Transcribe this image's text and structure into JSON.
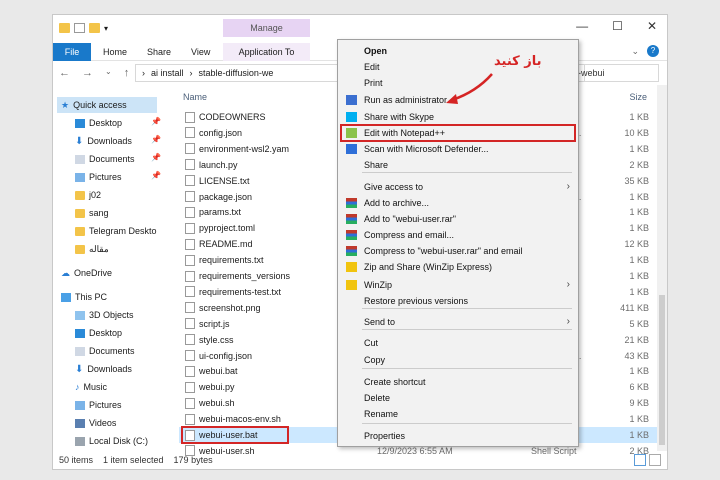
{
  "window": {
    "manage_label": "Manage",
    "tabs": [
      "File",
      "Home",
      "Share",
      "View",
      "Application To"
    ],
    "controls": [
      "—",
      "☐",
      "✕"
    ]
  },
  "address": {
    "parts": [
      "ai install",
      "stable-diffusion-we"
    ],
    "search_tail": "-webui"
  },
  "nav": {
    "quick_access": "Quick access",
    "items": [
      "Desktop",
      "Downloads",
      "Documents",
      "Pictures",
      "j02",
      "sang",
      "Telegram Deskto",
      "مقاله",
      "OneDrive",
      "This PC",
      "3D Objects",
      "Desktop",
      "Documents",
      "Downloads",
      "Music",
      "Pictures",
      "Videos",
      "Local Disk (C:)"
    ]
  },
  "columns": {
    "name": "Name",
    "size": "Size"
  },
  "files": [
    {
      "name": "CODEOWNERS",
      "type": "",
      "size": "1 KB"
    },
    {
      "name": "config.json",
      "type": "urce Effect...",
      "size": "10 KB"
    },
    {
      "name": "environment-wsl2.yam",
      "type": "",
      "size": "1 KB"
    },
    {
      "name": "launch.py",
      "type": "",
      "size": "2 KB"
    },
    {
      "name": "LICENSE.txt",
      "type": "ment",
      "size": "35 KB"
    },
    {
      "name": "package.json",
      "type": "urce Effect...",
      "size": "1 KB"
    },
    {
      "name": "params.txt",
      "type": "ment",
      "size": "1 KB"
    },
    {
      "name": "pyproject.toml",
      "type": "",
      "size": "1 KB"
    },
    {
      "name": "README.md",
      "type": "",
      "size": "12 KB"
    },
    {
      "name": "requirements.txt",
      "type": "ment",
      "size": "1 KB"
    },
    {
      "name": "requirements_versions",
      "type": "ment",
      "size": "1 KB"
    },
    {
      "name": "requirements-test.txt",
      "type": "ment",
      "size": "1 KB"
    },
    {
      "name": "screenshot.png",
      "type": "",
      "size": "411 KB"
    },
    {
      "name": "script.js",
      "type": "File",
      "size": "5 KB"
    },
    {
      "name": "style.css",
      "type": "Style S...",
      "size": "21 KB"
    },
    {
      "name": "ui-config.json",
      "type": "urce Effect...",
      "size": "43 KB"
    },
    {
      "name": "webui.bat",
      "type": "atch File",
      "size": "1 KB"
    },
    {
      "name": "webui.py",
      "type": "",
      "size": "6 KB"
    },
    {
      "name": "webui.sh",
      "type": "",
      "size": "9 KB"
    },
    {
      "name": "webui-macos-env.sh",
      "type": "",
      "size": "1 KB"
    },
    {
      "name": "webui-user.bat",
      "type": "atch File",
      "size": "1 KB"
    },
    {
      "name": "webui-user.sh",
      "date": "12/9/2023 6:55 AM",
      "type": "Shell Script",
      "size": "2 KB"
    }
  ],
  "status": {
    "count": "50 items",
    "selected": "1 item selected",
    "size": "179 bytes"
  },
  "context_menu": [
    {
      "label": "Open"
    },
    {
      "label": "Edit"
    },
    {
      "label": "Print"
    },
    {
      "label": "Run as administrator"
    },
    {
      "label": "Share with Skype"
    },
    {
      "label": "Edit with Notepad++"
    },
    {
      "label": "Scan with Microsoft Defender..."
    },
    {
      "label": "Share"
    },
    {
      "label": "Give access to"
    },
    {
      "label": "Add to archive..."
    },
    {
      "label": "Add to \"webui-user.rar\""
    },
    {
      "label": "Compress and email..."
    },
    {
      "label": "Compress to \"webui-user.rar\" and email"
    },
    {
      "label": "Zip and Share (WinZip Express)"
    },
    {
      "label": "WinZip"
    },
    {
      "label": "Restore previous versions"
    },
    {
      "label": "Send to"
    },
    {
      "label": "Cut"
    },
    {
      "label": "Copy"
    },
    {
      "label": "Create shortcut"
    },
    {
      "label": "Delete"
    },
    {
      "label": "Rename"
    },
    {
      "label": "Properties"
    }
  ],
  "annotation": "باز کنید"
}
